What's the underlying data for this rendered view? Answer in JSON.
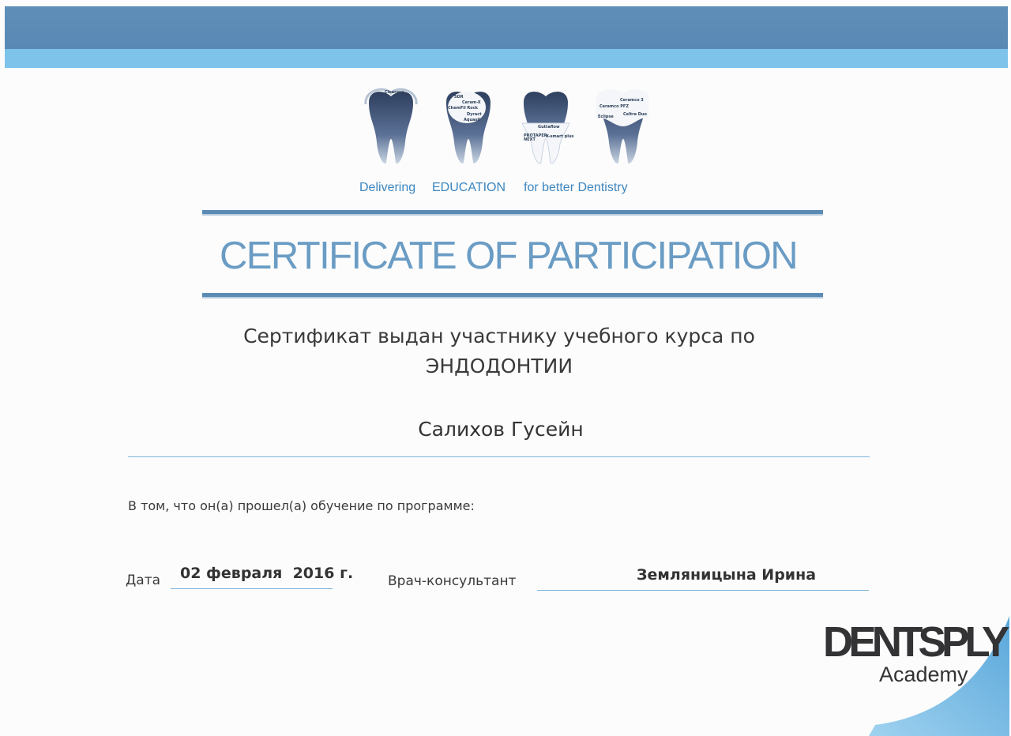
{
  "header": {
    "tooth_words": [
      [
        "Cleaners"
      ],
      [
        "SDR",
        "Ceram-X",
        "ChemFil Rock",
        "Dyract",
        "Aquasil"
      ],
      [
        "Guttaflow",
        "PROTAPER NEXT",
        "X-smart plus"
      ],
      [
        "Ceramco 3",
        "Ceramco PFZ",
        "Eclipse",
        "Celtra Duo"
      ]
    ],
    "tagline": [
      "Delivering",
      "EDUCATION",
      "for better Dentistry"
    ]
  },
  "certificate": {
    "title": "CERTIFICATE OF PARTICIPATION",
    "issued_line": "Сертификат выдан участнику учебного курса по",
    "course": "ЭНДОДОНТИИ",
    "participant_name": "Салихов Гусейн",
    "program_text": "В том, что он(а) прошел(а) обучение по программе:",
    "date_label": "Дата",
    "date_value": "02 февраля  2016 г.",
    "consultant_label": "Врач-консультант",
    "consultant_name": "Земляницына Ирина"
  },
  "brand": {
    "name": "DENTSPLY",
    "sub": "Academy"
  },
  "colors": {
    "band_dark": "#5f8fb9",
    "band_light": "#7ec3ea",
    "title_blue": "#6a9cc4",
    "tagline_blue": "#3c86c0",
    "tooth_dark": "#2f4160",
    "tooth_light": "#b7c8dc"
  }
}
